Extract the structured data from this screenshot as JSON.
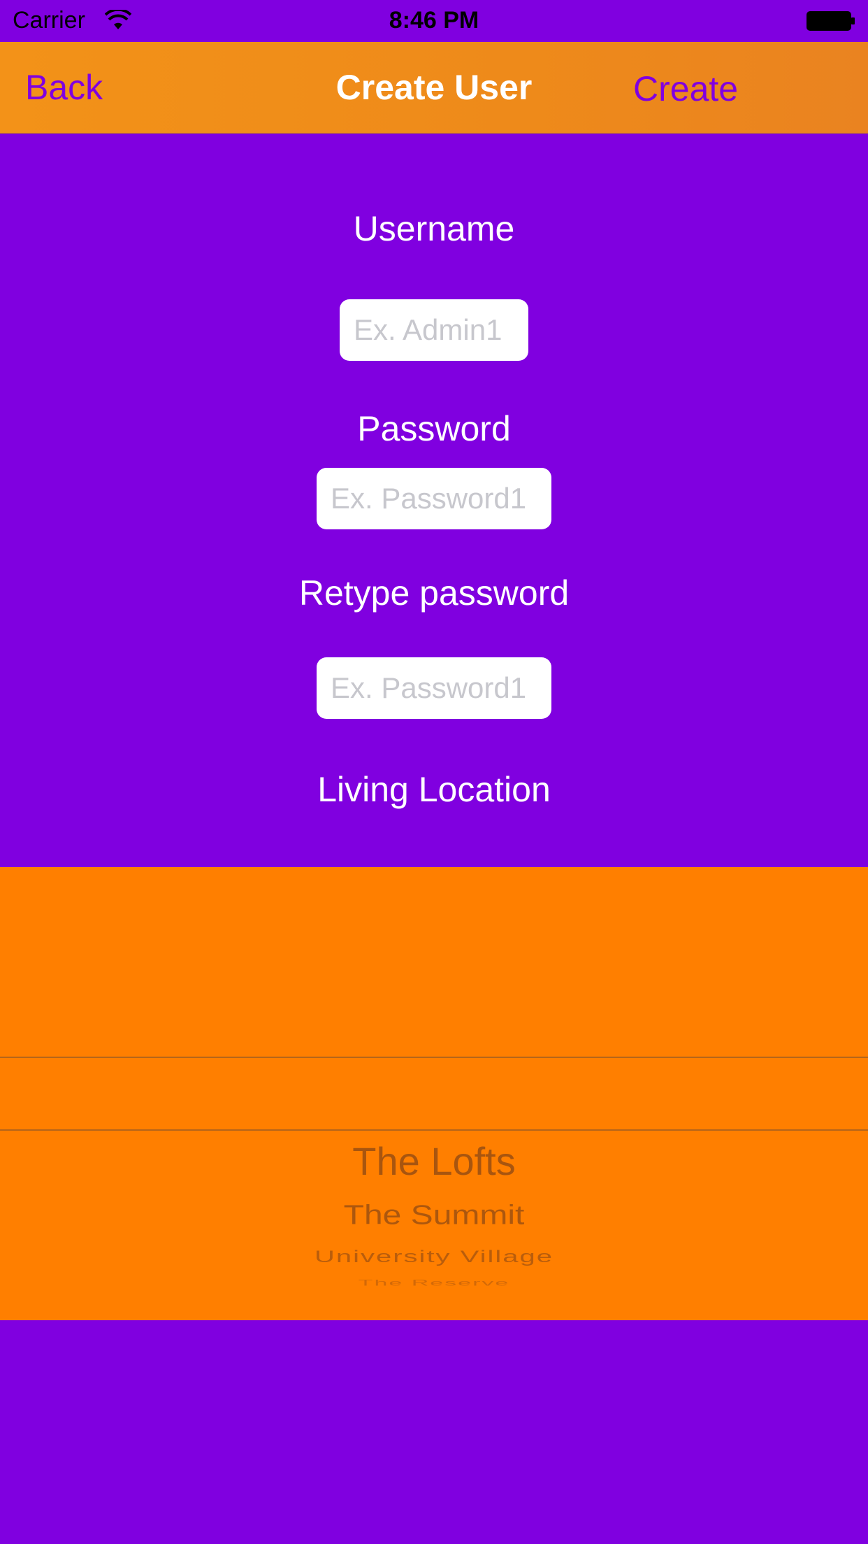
{
  "status_bar": {
    "carrier": "Carrier",
    "time": "8:46 PM",
    "wifi_icon": "wifi-icon",
    "battery_icon": "battery-icon"
  },
  "nav": {
    "back_label": "Back",
    "title": "Create User",
    "create_label": "Create"
  },
  "form": {
    "username_label": "Username",
    "username_placeholder": "Ex. Admin1",
    "username_value": "",
    "password_label": "Password",
    "password_placeholder": "Ex. Password1",
    "password_value": "",
    "retype_label": "Retype password",
    "retype_placeholder": "Ex. Password1",
    "retype_value": "",
    "location_label": "Living Location"
  },
  "location_picker": {
    "items": [
      "The Lofts",
      "The Summit",
      "University Village",
      "The Reserve"
    ]
  },
  "colors": {
    "background": "#8000E0",
    "nav_background": "#EE8A1A",
    "accent": "#8000E0",
    "picker_background": "#FF7F00",
    "picker_text": "#A8550F"
  }
}
